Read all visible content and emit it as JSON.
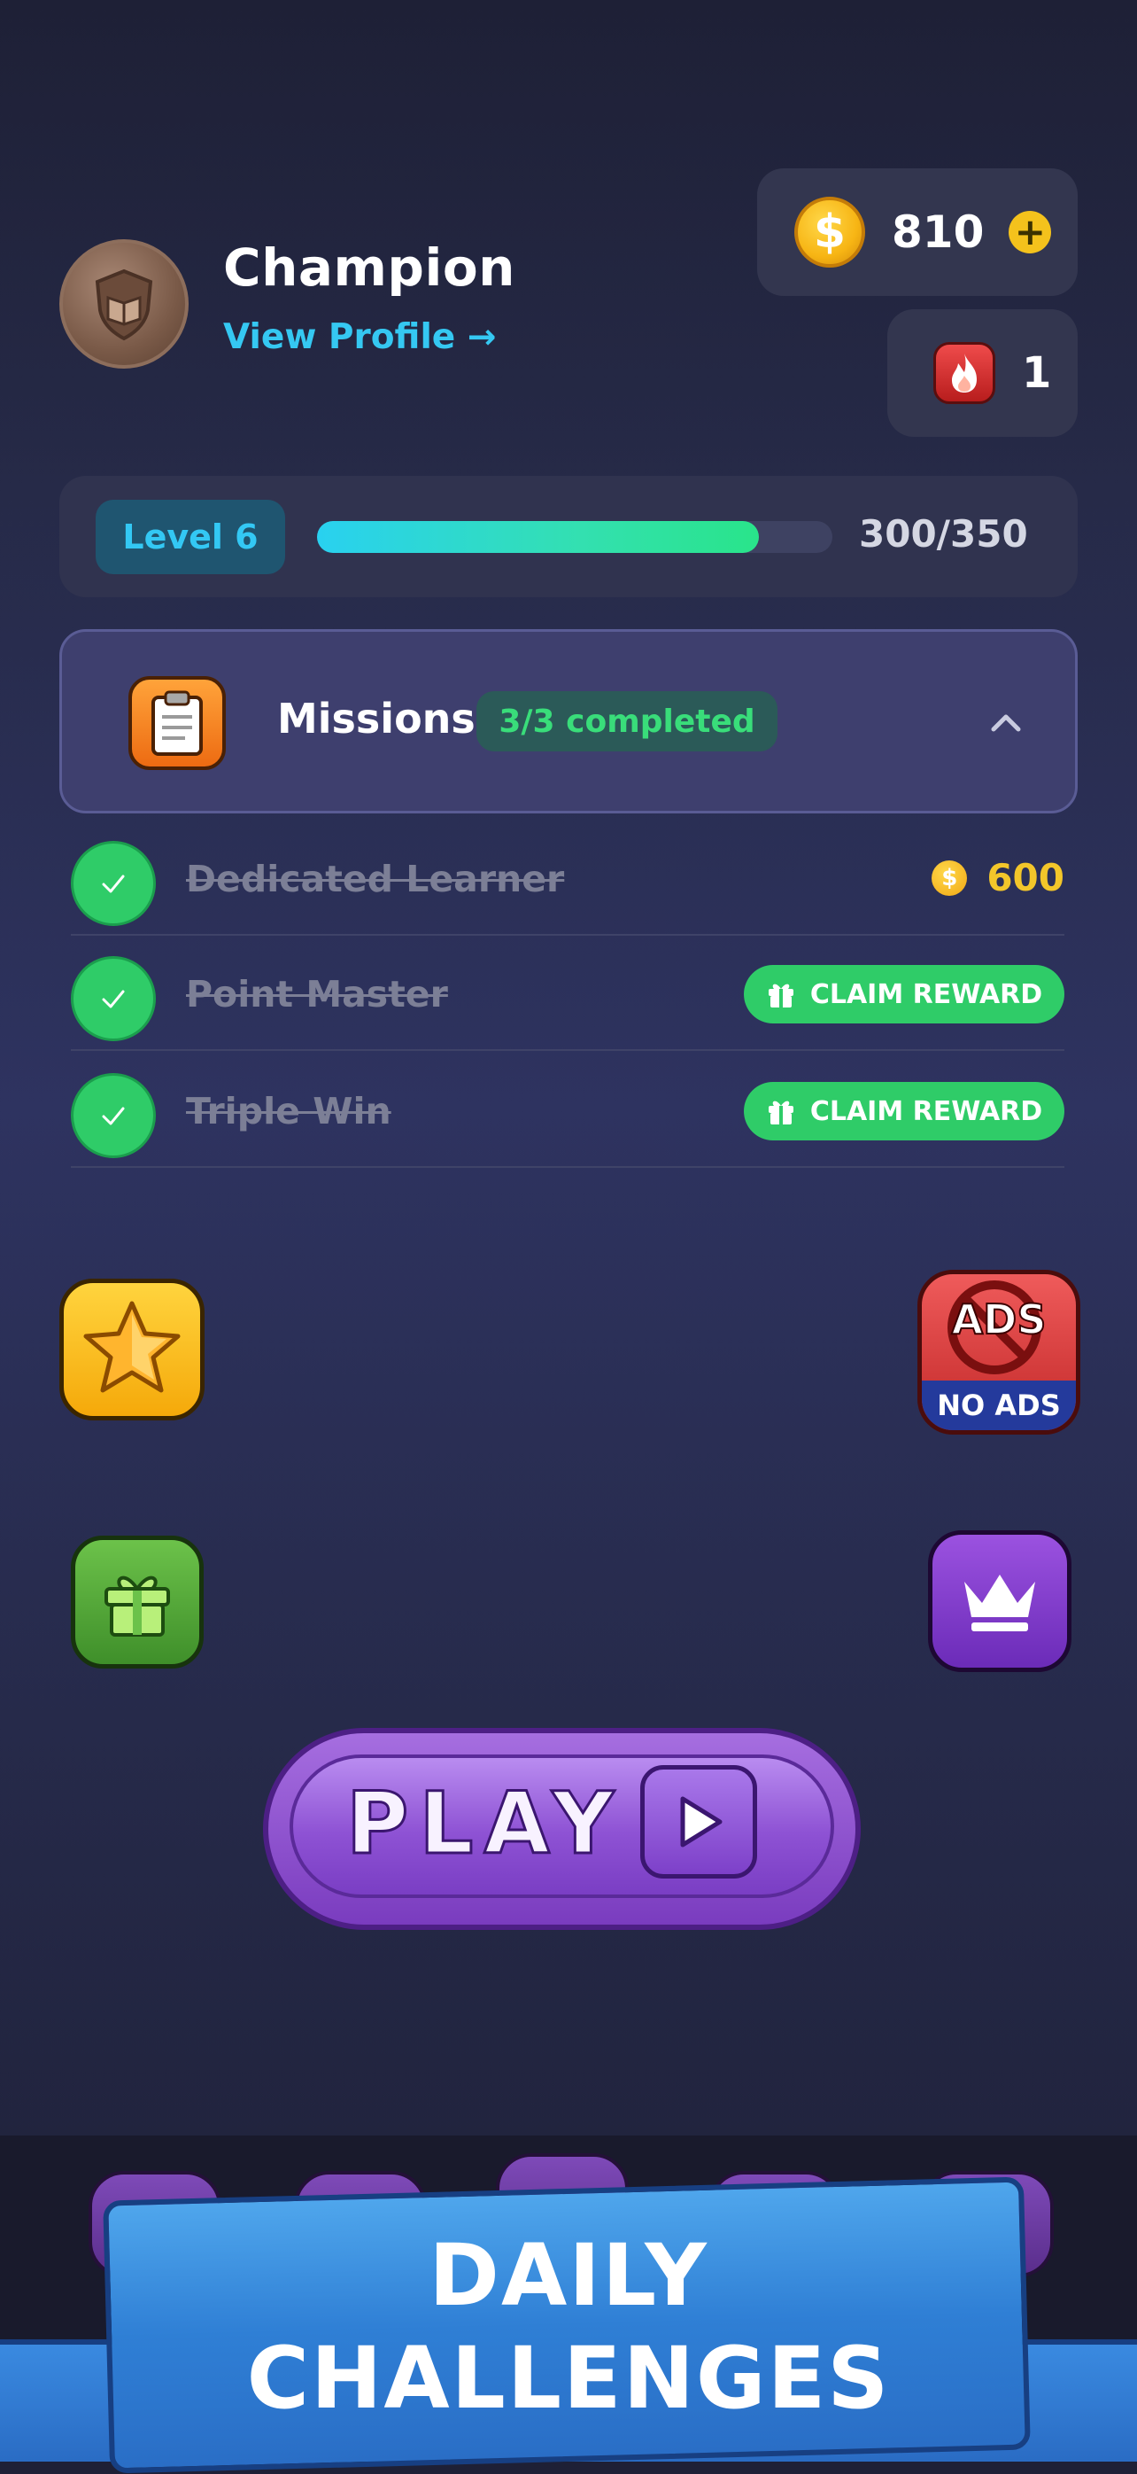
{
  "profile": {
    "name": "Champion",
    "view_profile_label": "View Profile →"
  },
  "currency": {
    "coins": "810",
    "coin_symbol": "$",
    "add_symbol": "+",
    "streak": "1"
  },
  "level": {
    "label": "Level 6",
    "xp_text": "300/350",
    "progress_fraction": 0.857
  },
  "missions": {
    "title": "Missions",
    "status": "3/3 completed",
    "items": [
      {
        "name": "Dedicated Learner",
        "reward_coins": "600",
        "coin_symbol": "$"
      },
      {
        "name": "Point Master",
        "action_label": "CLAIM REWARD"
      },
      {
        "name": "Triple Win",
        "action_label": "CLAIM REWARD"
      }
    ]
  },
  "side_buttons": {
    "ads_text": "ADS",
    "no_ads_label": "NO ADS"
  },
  "play": {
    "label": "PLAY"
  },
  "banner": {
    "line1": "DAILY",
    "line2": "CHALLENGES"
  },
  "colors": {
    "accent_cyan": "#35c8f2",
    "success_green": "#2fcc68",
    "coin_gold": "#f3c62a",
    "play_purple": "#8e52d4",
    "banner_blue": "#2f7fd5"
  }
}
